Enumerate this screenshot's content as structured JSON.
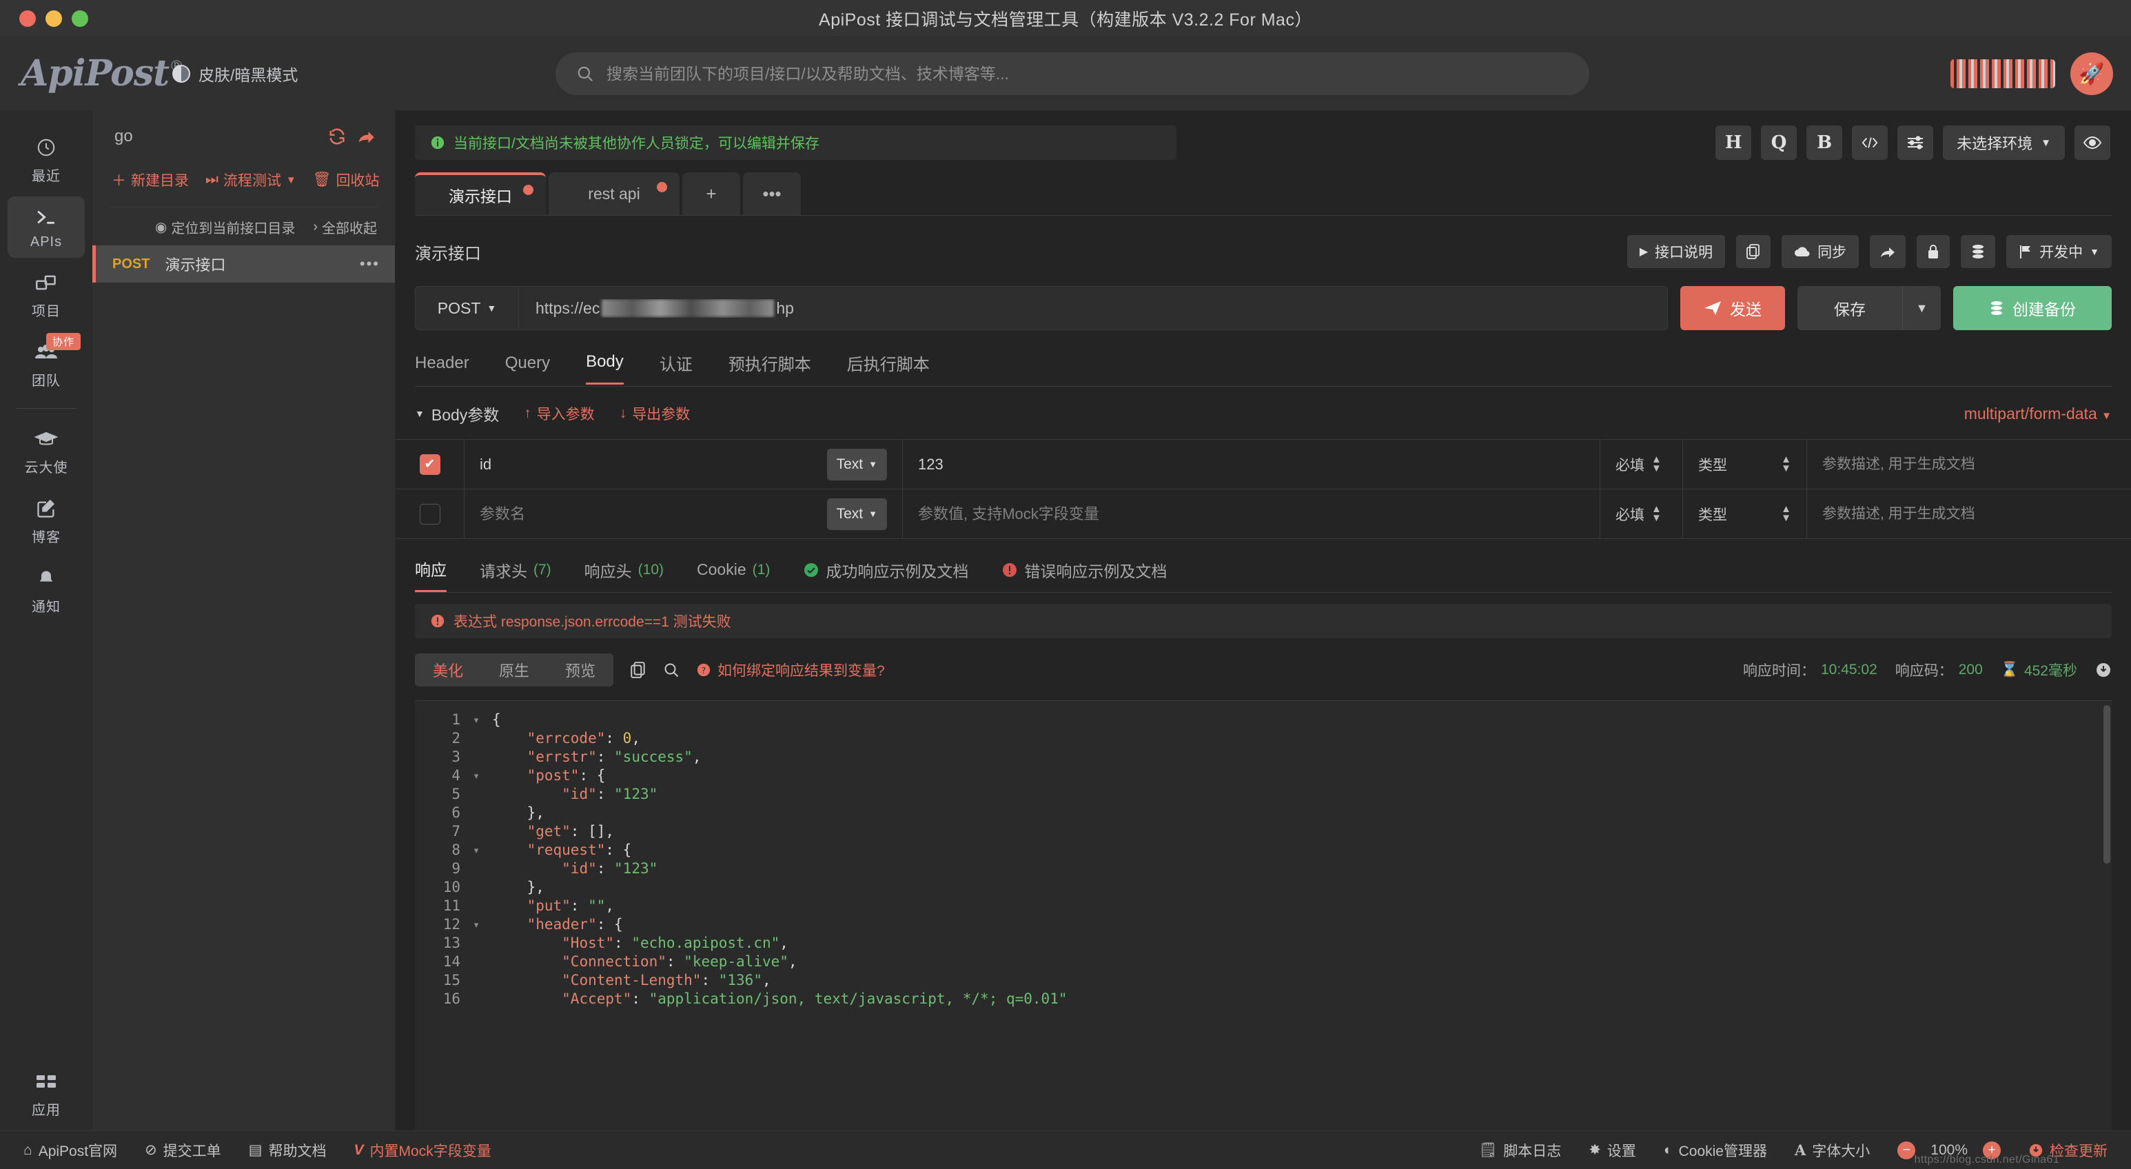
{
  "window": {
    "title": "ApiPost 接口调试与文档管理工具（构建版本 V3.2.2 For Mac）"
  },
  "header": {
    "logo": "ApiPost",
    "logo_registered": "®",
    "skin_toggle_label": "皮肤/暗黑模式",
    "search_placeholder": "搜索当前团队下的项目/接口/以及帮助文档、技术博客等..."
  },
  "rail": {
    "items": [
      {
        "label": "最近",
        "icon": "clock-icon",
        "active": false
      },
      {
        "label": "APIs",
        "icon": "terminal-icon",
        "active": true
      },
      {
        "label": "项目",
        "icon": "project-icon",
        "active": false
      },
      {
        "label": "团队",
        "icon": "team-icon",
        "active": false,
        "badge": "协作"
      },
      {
        "label": "云大使",
        "icon": "graduation-cap-icon",
        "active": false
      },
      {
        "label": "博客",
        "icon": "edit-icon",
        "active": false
      },
      {
        "label": "通知",
        "icon": "bell-icon",
        "active": false
      }
    ],
    "bottom": {
      "label": "应用",
      "icon": "apps-icon"
    }
  },
  "tree": {
    "project_name": "go",
    "actions": [
      {
        "label": "新建目录",
        "icon": "plus-icon"
      },
      {
        "label": "流程测试",
        "icon": "fast-forward-icon",
        "has_caret": true
      },
      {
        "label": "回收站",
        "icon": "trash-icon"
      }
    ],
    "sub_actions": [
      {
        "label": "定位到当前接口目录",
        "icon": "locate-icon"
      },
      {
        "label": "全部收起",
        "icon": "chevron-right-icon"
      }
    ],
    "rows": [
      {
        "method": "POST",
        "name": "演示接口",
        "selected": true
      }
    ]
  },
  "notice": {
    "icon": "info-icon",
    "text": "当前接口/文档尚未被其他协作人员锁定，可以编辑并保存"
  },
  "toolbar_icons": [
    {
      "name": "h-button",
      "label": "H"
    },
    {
      "name": "q-button",
      "label": "Q"
    },
    {
      "name": "b-button",
      "label": "B"
    },
    {
      "name": "code-button",
      "label": "</>"
    },
    {
      "name": "settings-sliders-button",
      "label": "sliders-icon"
    },
    {
      "name": "environment-select",
      "label": "未选择环境",
      "caret": true
    },
    {
      "name": "eye-button",
      "label": "eye-icon"
    }
  ],
  "tabs": [
    {
      "label": "演示接口",
      "active": true,
      "dirty": true
    },
    {
      "label": "rest api",
      "active": false,
      "dirty": true
    },
    {
      "label": "+",
      "mini": true
    },
    {
      "label": "•••",
      "mini": true
    }
  ],
  "api": {
    "title": "演示接口",
    "actions": [
      {
        "label": "接口说明",
        "icon": "play-icon"
      },
      {
        "label": "",
        "icon": "copy-icon"
      },
      {
        "label": "同步",
        "icon": "cloud-download-icon"
      },
      {
        "label": "",
        "icon": "share-icon"
      },
      {
        "label": "",
        "icon": "lock-icon"
      },
      {
        "label": "",
        "icon": "database-icon"
      },
      {
        "label": "开发中",
        "icon": "flag-icon",
        "caret": true
      }
    ],
    "method": "POST",
    "url_prefix": "https://ec",
    "url_suffix": "hp",
    "url_redacted": true,
    "send_label": "发送",
    "save_label": "保存",
    "backup_label": "创建备份"
  },
  "request_tabs": [
    {
      "label": "Header",
      "active": false
    },
    {
      "label": "Query",
      "active": false
    },
    {
      "label": "Body",
      "active": true
    },
    {
      "label": "认证",
      "active": false
    },
    {
      "label": "预执行脚本",
      "active": false
    },
    {
      "label": "后执行脚本",
      "active": false
    }
  ],
  "body_params": {
    "section_label": "Body参数",
    "import_label": "导入参数",
    "export_label": "导出参数",
    "content_type": "multipart/form-data",
    "col_required": "必填",
    "col_type": "类型",
    "desc_placeholder": "参数描述, 用于生成文档",
    "name_placeholder": "参数名",
    "value_placeholder": "参数值, 支持Mock字段变量",
    "rows": [
      {
        "checked": true,
        "name": "id",
        "type": "Text",
        "value": "123",
        "required": "必填",
        "vtype": "类型",
        "desc": ""
      },
      {
        "checked": false,
        "name": "",
        "type": "Text",
        "value": "",
        "required": "必填",
        "vtype": "类型",
        "desc": ""
      }
    ]
  },
  "response_tabs": [
    {
      "label": "响应",
      "count": "",
      "active": true
    },
    {
      "label": "请求头",
      "count": "(7)",
      "active": false
    },
    {
      "label": "响应头",
      "count": "(10)",
      "active": false
    },
    {
      "label": "Cookie",
      "count": "(1)",
      "active": false
    },
    {
      "label": "成功响应示例及文档",
      "count": "",
      "active": false,
      "icon": "check-circle-icon"
    },
    {
      "label": "错误响应示例及文档",
      "count": "",
      "active": false,
      "icon": "error-circle-icon"
    }
  ],
  "test_error": {
    "icon": "error-icon",
    "text": "表达式 response.json.errcode==1 测试失败"
  },
  "response_bar": {
    "view_modes": [
      {
        "label": "美化",
        "active": true
      },
      {
        "label": "原生",
        "active": false
      },
      {
        "label": "预览",
        "active": false
      }
    ],
    "copy_icon": "copy-icon",
    "search_icon": "search-icon",
    "help_link": "如何绑定响应结果到变量?",
    "time_label": "响应时间：",
    "time_value": "10:45:02",
    "code_label": "响应码：",
    "code_value": "200",
    "duration_value": "452毫秒",
    "download_icon": "download-icon"
  },
  "response_body": {
    "lines": [
      {
        "n": 1,
        "fold": true,
        "tokens": [
          {
            "t": "p",
            "v": "{"
          }
        ]
      },
      {
        "n": 2,
        "fold": false,
        "tokens": [
          {
            "t": "p",
            "v": "    "
          },
          {
            "t": "k",
            "v": "\"errcode\""
          },
          {
            "t": "p",
            "v": ": "
          },
          {
            "t": "n",
            "v": "0"
          },
          {
            "t": "p",
            "v": ","
          }
        ]
      },
      {
        "n": 3,
        "fold": false,
        "tokens": [
          {
            "t": "p",
            "v": "    "
          },
          {
            "t": "k",
            "v": "\"errstr\""
          },
          {
            "t": "p",
            "v": ": "
          },
          {
            "t": "s",
            "v": "\"success\""
          },
          {
            "t": "p",
            "v": ","
          }
        ]
      },
      {
        "n": 4,
        "fold": true,
        "tokens": [
          {
            "t": "p",
            "v": "    "
          },
          {
            "t": "k",
            "v": "\"post\""
          },
          {
            "t": "p",
            "v": ": {"
          }
        ]
      },
      {
        "n": 5,
        "fold": false,
        "tokens": [
          {
            "t": "p",
            "v": "        "
          },
          {
            "t": "k",
            "v": "\"id\""
          },
          {
            "t": "p",
            "v": ": "
          },
          {
            "t": "s",
            "v": "\"123\""
          }
        ]
      },
      {
        "n": 6,
        "fold": false,
        "tokens": [
          {
            "t": "p",
            "v": "    },"
          }
        ]
      },
      {
        "n": 7,
        "fold": false,
        "tokens": [
          {
            "t": "p",
            "v": "    "
          },
          {
            "t": "k",
            "v": "\"get\""
          },
          {
            "t": "p",
            "v": ": [],"
          }
        ]
      },
      {
        "n": 8,
        "fold": true,
        "tokens": [
          {
            "t": "p",
            "v": "    "
          },
          {
            "t": "k",
            "v": "\"request\""
          },
          {
            "t": "p",
            "v": ": {"
          }
        ]
      },
      {
        "n": 9,
        "fold": false,
        "tokens": [
          {
            "t": "p",
            "v": "        "
          },
          {
            "t": "k",
            "v": "\"id\""
          },
          {
            "t": "p",
            "v": ": "
          },
          {
            "t": "s",
            "v": "\"123\""
          }
        ]
      },
      {
        "n": 10,
        "fold": false,
        "tokens": [
          {
            "t": "p",
            "v": "    },"
          }
        ]
      },
      {
        "n": 11,
        "fold": false,
        "tokens": [
          {
            "t": "p",
            "v": "    "
          },
          {
            "t": "k",
            "v": "\"put\""
          },
          {
            "t": "p",
            "v": ": "
          },
          {
            "t": "s",
            "v": "\"\""
          },
          {
            "t": "p",
            "v": ","
          }
        ]
      },
      {
        "n": 12,
        "fold": true,
        "tokens": [
          {
            "t": "p",
            "v": "    "
          },
          {
            "t": "k",
            "v": "\"header\""
          },
          {
            "t": "p",
            "v": ": {"
          }
        ]
      },
      {
        "n": 13,
        "fold": false,
        "tokens": [
          {
            "t": "p",
            "v": "        "
          },
          {
            "t": "k",
            "v": "\"Host\""
          },
          {
            "t": "p",
            "v": ": "
          },
          {
            "t": "s",
            "v": "\"echo.apipost.cn\""
          },
          {
            "t": "p",
            "v": ","
          }
        ]
      },
      {
        "n": 14,
        "fold": false,
        "tokens": [
          {
            "t": "p",
            "v": "        "
          },
          {
            "t": "k",
            "v": "\"Connection\""
          },
          {
            "t": "p",
            "v": ": "
          },
          {
            "t": "s",
            "v": "\"keep-alive\""
          },
          {
            "t": "p",
            "v": ","
          }
        ]
      },
      {
        "n": 15,
        "fold": false,
        "tokens": [
          {
            "t": "p",
            "v": "        "
          },
          {
            "t": "k",
            "v": "\"Content-Length\""
          },
          {
            "t": "p",
            "v": ": "
          },
          {
            "t": "s",
            "v": "\"136\""
          },
          {
            "t": "p",
            "v": ","
          }
        ]
      },
      {
        "n": 16,
        "fold": false,
        "tokens": [
          {
            "t": "p",
            "v": "        "
          },
          {
            "t": "k",
            "v": "\"Accept\""
          },
          {
            "t": "p",
            "v": ": "
          },
          {
            "t": "s",
            "v": "\"application/json, text/javascript, */*; q=0.01\""
          }
        ]
      }
    ]
  },
  "status_bar": {
    "left": [
      {
        "label": "ApiPost官网",
        "icon": "home-icon",
        "accent": false
      },
      {
        "label": "提交工单",
        "icon": "question-circle-icon",
        "accent": false
      },
      {
        "label": "帮助文档",
        "icon": "book-icon",
        "accent": false
      },
      {
        "label": "内置Mock字段变量",
        "icon": "v-icon",
        "accent": true
      }
    ],
    "right": [
      {
        "label": "脚本日志",
        "icon": "script-icon"
      },
      {
        "label": "设置",
        "icon": "gear-icon"
      },
      {
        "label": "Cookie管理器",
        "icon": "cookie-icon"
      },
      {
        "label": "字体大小",
        "icon": "font-size-icon"
      }
    ],
    "zoom_minus": "−",
    "zoom_value": "100%",
    "zoom_plus": "+",
    "update_label": "检查更新",
    "update_icon": "update-icon",
    "watermark": "https://blog.csdn.net/Gina61"
  }
}
